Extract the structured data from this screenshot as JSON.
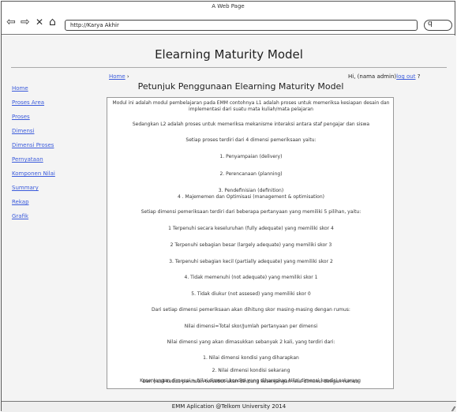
{
  "browser": {
    "title": "A Web Page",
    "address": "http://Karya Akhir",
    "back_icon": "back-arrow-icon",
    "forward_icon": "forward-arrow-icon",
    "stop_icon": "close-icon",
    "home_icon": "home-icon",
    "search_icon": "search-icon",
    "back_glyph": "⇦",
    "forward_glyph": "⇨",
    "stop_glyph": "✕",
    "home_glyph": "⌂",
    "search_glyph": "q"
  },
  "header": {
    "app_title": "Elearning Maturity Model"
  },
  "breadcrumb": {
    "home": "Home",
    "sep": "›"
  },
  "user": {
    "greeting": "Hi, (nama admin)",
    "logout": "log out",
    "help": "?"
  },
  "sidebar": {
    "items": [
      {
        "label": "Home"
      },
      {
        "label": "Proses Area"
      },
      {
        "label": "Proses"
      },
      {
        "label": "Dimensi"
      },
      {
        "label": "Dimensi Proses"
      },
      {
        "label": "Pernyataan"
      },
      {
        "label": "Komponen Nilai"
      },
      {
        "label": "Summary"
      },
      {
        "label": "Rekap"
      },
      {
        "label": "Grafik"
      }
    ]
  },
  "main": {
    "title": "Petunjuk Penggunaan Elearning Maturity Model",
    "paragraphs": [
      "Modul ini adalah modul pembelajaran pada EMM contohnya L1 adalah proses untuk memeriksa kesiapan desain dan",
      "implementasi dari suatu mata kuliah/mata pelajaran",
      "Sedangkan L2 adalah proses untuk memeriksa mekanisme interaksi antara staf pengajar dan siswa",
      "Setiap proses terdiri dari 4 dimensi pemeriksaan yaitu:",
      "1. Penyampaian (delivery)",
      "2. Perencanaan (planning)",
      "3. Pendefinisian (definition)",
      "4 . Majememen dan Optimisasi (management & optimisation)",
      "Setiap dimensi pemeriksaan terdiri dari beberapa pertanyaan yang memiliki 5 pilihan, yaitu:",
      "1 Terpenuhi secara keseluruhan (fully adequate) yang memiliki skor 4",
      "2 Terpenuhi sebagian besar (largely adequate) yang memiliki skor 3",
      "3. Terpenuhi sebagian kecil (partially adequate) yang memiliki skor 2",
      "4. Tidak memenuhi (not adequate) yang memiliki skor 1",
      "5. Tidak diukur (not assesed) yang memiliki skor 0",
      "Dari setiap dimensi pemeriksaan akan dihitung skor masing-masing dengan rumus:",
      "Nilai dimensi=Total skor/Jumlah pertanyaan per dimensi",
      "Nilai dimensi yang akan dimasukkan sebanyak 2 kali, yang terdiri dari:",
      "1. Nilai dimensi kondisi yang diharapkan",
      "2. Nilai dimensi kondisi sekarang",
      "Dari hasil kedua penilaian tersebut akan dihitung kesenjangan nilai dimensi dengan rumus:",
      "Kesenjangan dimensi = Nilai dimensi kondisi yang diharapkan  Nilai dimensi kondisi sekarang"
    ]
  },
  "footer": {
    "text": "EMM Aplication @Telkom University 2014",
    "grip_icon": "resize-grip-icon",
    "grip_glyph": "⁄⁄"
  }
}
